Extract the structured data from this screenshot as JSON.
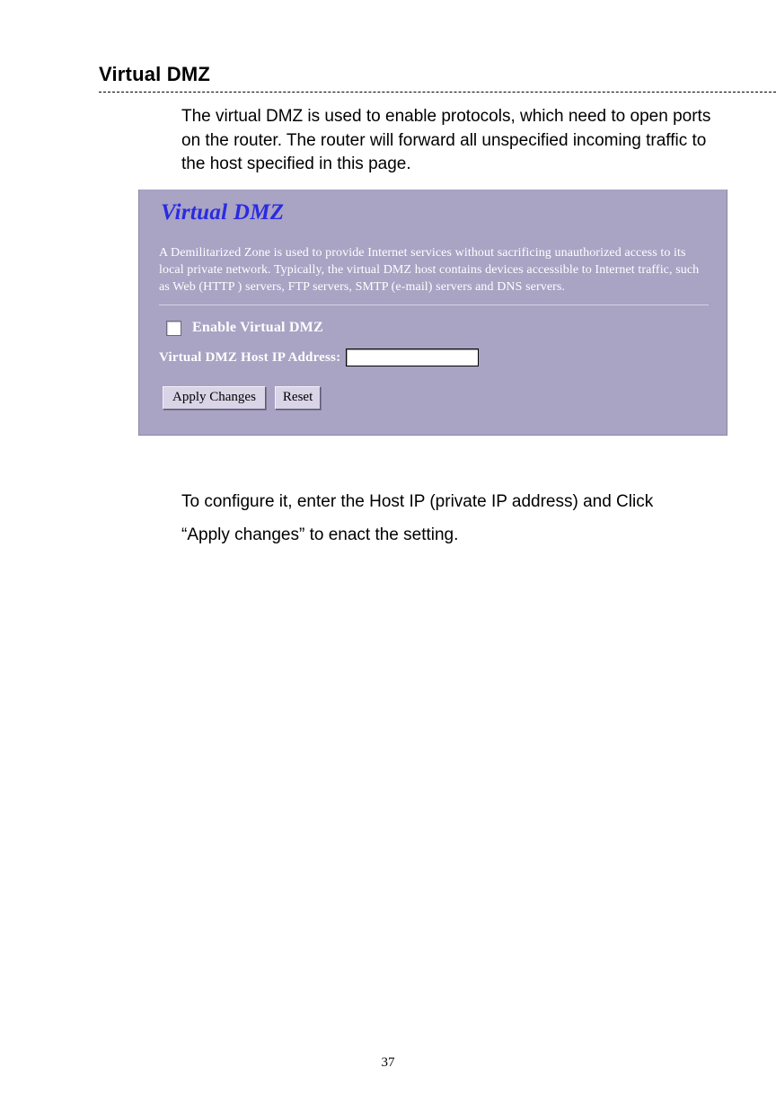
{
  "section": {
    "heading": "Virtual DMZ",
    "intro": "The virtual DMZ is used to enable protocols, which need to open ports on the router. The router will forward all unspecified incoming traffic to the host specified in this page.",
    "outro": "To configure it, enter the Host IP (private IP address) and Click “Apply changes” to enact the setting."
  },
  "panel": {
    "title": "Virtual DMZ",
    "description": "A Demilitarized Zone is used to provide Internet services without sacrificing unauthorized access to its local private network. Typically, the virtual DMZ host contains devices accessible to Internet traffic, such as Web (HTTP ) servers, FTP servers, SMTP (e-mail) servers and DNS servers.",
    "enable_label": "Enable Virtual DMZ",
    "ip_label": "Virtual DMZ Host IP Address:",
    "ip_value": "",
    "apply_label": "Apply Changes",
    "reset_label": "Reset"
  },
  "page_number": "37"
}
